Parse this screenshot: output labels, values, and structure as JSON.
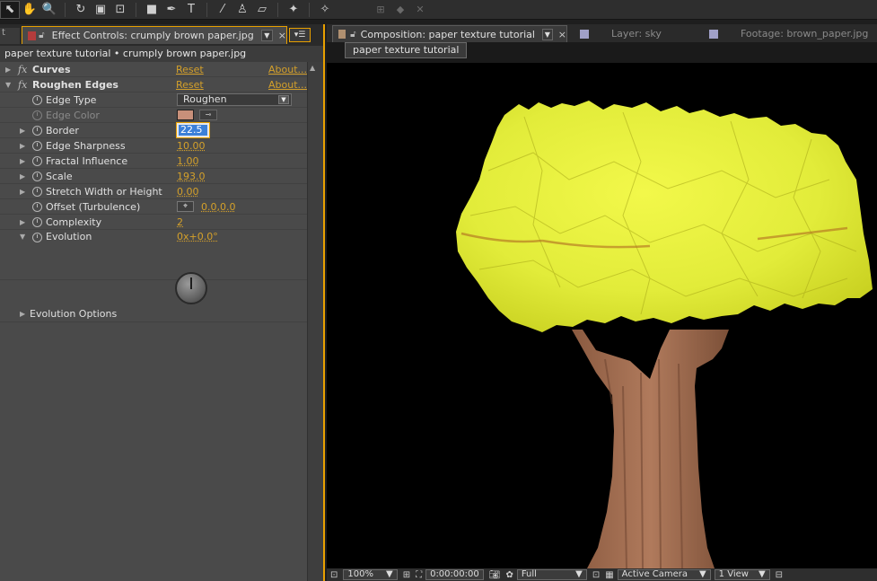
{
  "toolbar": {
    "tools": [
      {
        "name": "selection-tool",
        "glyph": "⬉",
        "active": true
      },
      {
        "name": "hand-tool",
        "glyph": "✋",
        "active": false
      },
      {
        "name": "zoom-tool",
        "glyph": "🔍",
        "active": false
      },
      {
        "name": "rotate-tool",
        "glyph": "↻",
        "active": false
      },
      {
        "name": "camera-tool",
        "glyph": "▣",
        "active": false
      },
      {
        "name": "pan-behind-tool",
        "glyph": "⊡",
        "active": false
      },
      {
        "name": "rectangle-tool",
        "glyph": "■",
        "active": false
      },
      {
        "name": "pen-tool",
        "glyph": "✒",
        "active": false
      },
      {
        "name": "type-tool",
        "glyph": "T",
        "active": false
      },
      {
        "name": "brush-tool",
        "glyph": "⁄",
        "active": false
      },
      {
        "name": "clone-stamp-tool",
        "glyph": "♙",
        "active": false
      },
      {
        "name": "eraser-tool",
        "glyph": "▱",
        "active": false
      },
      {
        "name": "roto-brush-tool",
        "glyph": "✦",
        "active": false
      },
      {
        "name": "puppet-pin-tool",
        "glyph": "✧",
        "active": false
      }
    ],
    "axis_icons": [
      "⊞",
      "◆",
      "✕"
    ]
  },
  "effect_controls": {
    "tab_stub": "t",
    "tab_title": "Effect Controls: crumply brown paper.jpg",
    "breadcrumb": "paper texture tutorial • crumply brown paper.jpg",
    "curves": {
      "label": "Curves",
      "reset": "Reset",
      "about": "About..."
    },
    "roughen": {
      "label": "Roughen Edges",
      "reset": "Reset",
      "about": "About..."
    },
    "edge_type": {
      "label": "Edge Type",
      "value": "Roughen"
    },
    "edge_color": {
      "label": "Edge Color",
      "swatch": "#c8907a"
    },
    "border": {
      "label": "Border",
      "value": "22.5"
    },
    "edge_sharpness": {
      "label": "Edge Sharpness",
      "value": "10.00"
    },
    "fractal_influence": {
      "label": "Fractal Influence",
      "value": "1.00"
    },
    "scale": {
      "label": "Scale",
      "value": "193.0"
    },
    "stretch": {
      "label": "Stretch Width or Height",
      "value": "0.00"
    },
    "offset": {
      "label": "Offset (Turbulence)",
      "value": "0.0,0.0"
    },
    "complexity": {
      "label": "Complexity",
      "value": "2"
    },
    "evolution": {
      "label": "Evolution",
      "value": "0x+0.0°"
    },
    "evolution_options": {
      "label": "Evolution Options"
    }
  },
  "composition": {
    "tab_title": "Composition: paper texture tutorial",
    "layer_tab": "Layer: sky",
    "footage_tab": "Footage: brown_paper.jpg",
    "sub_tab": "paper texture tutorial",
    "bottom_bar": {
      "zoom": "100%",
      "timecode": "0:00:00:00",
      "resolution": "Full",
      "camera": "Active Camera",
      "views": "1 View"
    }
  },
  "colors": {
    "accent": "#e8a000",
    "value_orange": "#d4a02a",
    "canopy": "#e8f040",
    "trunk": "#a06a4a"
  }
}
